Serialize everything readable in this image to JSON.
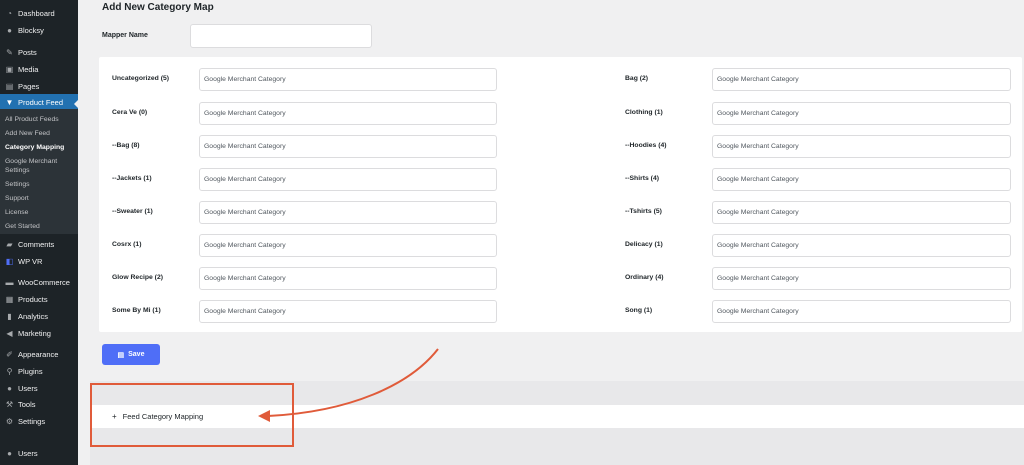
{
  "sidebar": {
    "items": [
      {
        "label": "Dashboard",
        "icon": "dashboard-icon"
      },
      {
        "label": "Blocksy",
        "icon": "blocksy-icon"
      },
      {
        "label": "Posts",
        "icon": "pin-icon"
      },
      {
        "label": "Media",
        "icon": "media-icon"
      },
      {
        "label": "Pages",
        "icon": "pages-icon"
      },
      {
        "label": "Product Feed",
        "icon": "product-feed-icon"
      },
      {
        "label": "Comments",
        "icon": "comments-icon"
      },
      {
        "label": "WP VR",
        "icon": "wpvr-icon"
      },
      {
        "label": "WooCommerce",
        "icon": "woocommerce-icon"
      },
      {
        "label": "Products",
        "icon": "products-icon"
      },
      {
        "label": "Analytics",
        "icon": "analytics-icon"
      },
      {
        "label": "Marketing",
        "icon": "marketing-icon"
      },
      {
        "label": "Appearance",
        "icon": "appearance-icon"
      },
      {
        "label": "Plugins",
        "icon": "plugins-icon"
      },
      {
        "label": "Users",
        "icon": "users-icon"
      },
      {
        "label": "Tools",
        "icon": "tools-icon"
      },
      {
        "label": "Settings",
        "icon": "settings-icon"
      },
      {
        "label": "Users",
        "icon": "users-icon"
      }
    ],
    "submenu": [
      {
        "label": "All Product Feeds"
      },
      {
        "label": "Add New Feed"
      },
      {
        "label": "Category Mapping"
      },
      {
        "label": "Google Merchant"
      },
      {
        "label": "Settings"
      },
      {
        "label": "Settings"
      },
      {
        "label": "Support"
      },
      {
        "label": "License"
      },
      {
        "label": "Get Started"
      }
    ]
  },
  "page": {
    "title": "Add New Category Map",
    "mapper_label": "Mapper Name",
    "mapper_value": "",
    "placeholder": "Google Merchant Category",
    "save_label": "Save",
    "accordion_label": "Feed Category Mapping",
    "accordion_plus": "+"
  },
  "categories_left": [
    {
      "label": "Uncategorized (5)"
    },
    {
      "label": "Cera Ve (0)"
    },
    {
      "label": "--Bag (8)"
    },
    {
      "label": "--Jackets (1)"
    },
    {
      "label": "--Sweater (1)"
    },
    {
      "label": "Cosrx (1)"
    },
    {
      "label": "Glow Recipe (2)"
    },
    {
      "label": "Some By Mi (1)"
    }
  ],
  "categories_right": [
    {
      "label": "Bag (2)"
    },
    {
      "label": "Clothing (1)"
    },
    {
      "label": "--Hoodies (4)"
    },
    {
      "label": "--Shirts (4)"
    },
    {
      "label": "--Tshirts (5)"
    },
    {
      "label": "Delicacy (1)"
    },
    {
      "label": "Ordinary (4)"
    },
    {
      "label": "Song (1)"
    }
  ],
  "colors": {
    "accent": "#2271b1",
    "save_button": "#4f6ef7",
    "annotation": "#e05b3a",
    "sidebar_bg": "#1d2327"
  }
}
